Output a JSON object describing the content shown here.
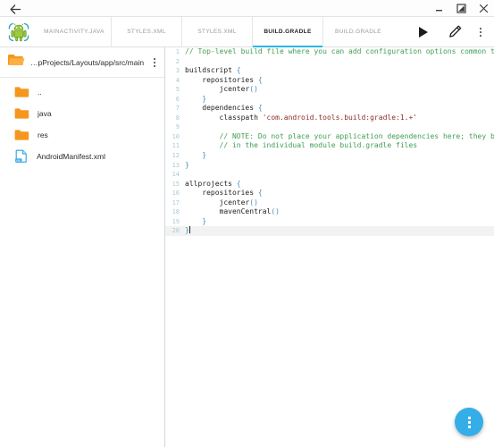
{
  "window": {
    "back_label": "←",
    "controls": [
      {
        "name": "minimize",
        "glyph": "—"
      },
      {
        "name": "maximize",
        "glyph": "❐"
      },
      {
        "name": "close",
        "glyph": "✕"
      }
    ]
  },
  "toolbar": {
    "logo_name": "android-logo",
    "tabs": [
      {
        "label": "MAINACTIVITY.JAVA",
        "active": false
      },
      {
        "label": "STYLES.XML",
        "active": false
      },
      {
        "label": "STYLES.XML",
        "active": false
      },
      {
        "label": "BUILD.GRADLE",
        "active": true
      },
      {
        "label": "BUILD.GRADLE",
        "active": false
      }
    ],
    "actions": [
      {
        "name": "run-button",
        "icon": "play-icon"
      },
      {
        "name": "edit-button",
        "icon": "pencil-icon"
      },
      {
        "name": "overflow-menu-button",
        "icon": "more-vertical-icon"
      }
    ],
    "accent_color": "#29b6e8"
  },
  "sidebar": {
    "path": "…pProjects/Layouts/app/src/main",
    "menu_icon": "more-vertical-icon",
    "files": [
      {
        "name": "..",
        "type": "folder"
      },
      {
        "name": "java",
        "type": "folder"
      },
      {
        "name": "res",
        "type": "folder"
      },
      {
        "name": "AndroidManifest.xml",
        "type": "xml-file"
      }
    ],
    "folder_color": "#f5971f",
    "xml_file_color": "#29a3dc"
  },
  "editor": {
    "filename": "build.gradle",
    "cursor_line": 20,
    "colors": {
      "comment": "#3f9e52",
      "string": "#8f2b2b",
      "punctuation": "#4a90b8",
      "gutter": "#a9cbd6",
      "current_line_bg": "#f2f2f2"
    },
    "lines": [
      {
        "n": 1,
        "tokens": [
          {
            "t": "comment",
            "v": "// Top-level build file where you can add configuration options common to all sub-projects/modules."
          }
        ]
      },
      {
        "n": 2,
        "tokens": []
      },
      {
        "n": 3,
        "tokens": [
          {
            "t": "plain",
            "v": "buildscript "
          },
          {
            "t": "punc",
            "v": "{"
          }
        ]
      },
      {
        "n": 4,
        "tokens": [
          {
            "t": "plain",
            "v": "    repositories "
          },
          {
            "t": "punc",
            "v": "{"
          }
        ]
      },
      {
        "n": 5,
        "tokens": [
          {
            "t": "plain",
            "v": "        jcenter"
          },
          {
            "t": "punc",
            "v": "()"
          }
        ]
      },
      {
        "n": 6,
        "tokens": [
          {
            "t": "punc",
            "v": "    }"
          }
        ]
      },
      {
        "n": 7,
        "tokens": [
          {
            "t": "plain",
            "v": "    dependencies "
          },
          {
            "t": "punc",
            "v": "{"
          }
        ]
      },
      {
        "n": 8,
        "tokens": [
          {
            "t": "plain",
            "v": "        classpath "
          },
          {
            "t": "str",
            "v": "'com.android.tools.build:gradle:1.+'"
          }
        ]
      },
      {
        "n": 9,
        "tokens": []
      },
      {
        "n": 10,
        "tokens": [
          {
            "t": "comment",
            "v": "        // NOTE: Do not place your application dependencies here; they belong"
          }
        ]
      },
      {
        "n": 11,
        "tokens": [
          {
            "t": "comment",
            "v": "        // in the individual module build.gradle files"
          }
        ]
      },
      {
        "n": 12,
        "tokens": [
          {
            "t": "punc",
            "v": "    }"
          }
        ]
      },
      {
        "n": 13,
        "tokens": [
          {
            "t": "punc",
            "v": "}"
          }
        ]
      },
      {
        "n": 14,
        "tokens": []
      },
      {
        "n": 15,
        "tokens": [
          {
            "t": "plain",
            "v": "allprojects "
          },
          {
            "t": "punc",
            "v": "{"
          }
        ]
      },
      {
        "n": 16,
        "tokens": [
          {
            "t": "plain",
            "v": "    repositories "
          },
          {
            "t": "punc",
            "v": "{"
          }
        ]
      },
      {
        "n": 17,
        "tokens": [
          {
            "t": "plain",
            "v": "        jcenter"
          },
          {
            "t": "punc",
            "v": "()"
          }
        ]
      },
      {
        "n": 18,
        "tokens": [
          {
            "t": "plain",
            "v": "        mavenCentral"
          },
          {
            "t": "punc",
            "v": "()"
          }
        ]
      },
      {
        "n": 19,
        "tokens": [
          {
            "t": "punc",
            "v": "    }"
          }
        ]
      },
      {
        "n": 20,
        "tokens": [
          {
            "t": "punc",
            "v": "}"
          }
        ],
        "cursor": true
      }
    ]
  },
  "fab": {
    "name": "floating-action-button",
    "icon": "more-vertical-icon",
    "color": "#35aee8"
  }
}
